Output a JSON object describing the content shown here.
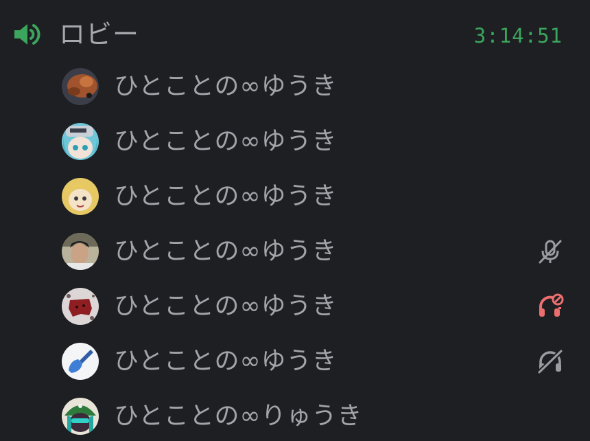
{
  "channel": {
    "name": "ロビー",
    "timer": "3:14:51",
    "icon": "speaker-icon",
    "accent_color": "#3ba55d"
  },
  "members": [
    {
      "name": "ひとことの∞ゆうき",
      "avatar": "avatar-orange-creature",
      "status_icon": ""
    },
    {
      "name": "ひとことの∞ゆうき",
      "avatar": "avatar-cap-anime",
      "status_icon": ""
    },
    {
      "name": "ひとことの∞ゆうき",
      "avatar": "avatar-blonde-anime",
      "status_icon": ""
    },
    {
      "name": "ひとことの∞ゆうき",
      "avatar": "avatar-photo",
      "status_icon": "muted-mic-icon"
    },
    {
      "name": "ひとことの∞ゆうき",
      "avatar": "avatar-red-blob",
      "status_icon": "server-deafened-icon"
    },
    {
      "name": "ひとことの∞ゆうき",
      "avatar": "avatar-blue-shovel",
      "status_icon": "deafened-headphones-icon"
    },
    {
      "name": "ひとことの∞りゅうき",
      "avatar": "avatar-green-hat",
      "status_icon": ""
    }
  ],
  "colors": {
    "background": "#1e1f22",
    "text": "#a3a4a9",
    "muted_icon": "#9b9ca1",
    "danger_icon": "#ed6e6e"
  }
}
